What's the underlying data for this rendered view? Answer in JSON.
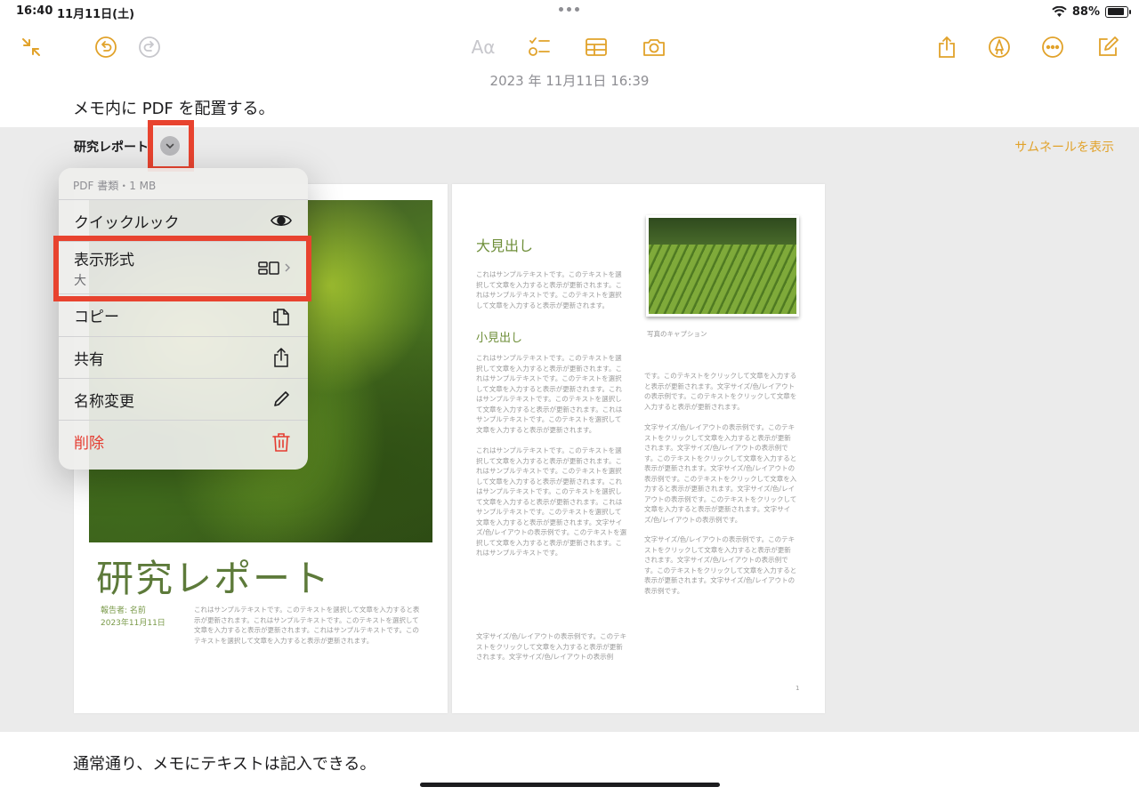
{
  "status_bar": {
    "time": "16:40",
    "date": "11月11日(土)",
    "battery": "88%"
  },
  "toolbar": {
    "font_button": "Aα",
    "icons": [
      "collapse-icon",
      "undo-icon",
      "redo-icon",
      "checklist-icon",
      "table-icon",
      "camera-icon",
      "share-icon",
      "markup-icon",
      "more-icon",
      "compose-icon"
    ]
  },
  "note": {
    "date": "2023 年 11月11日 16:39",
    "line1": "メモ内に PDF を配置する。",
    "line2": "通常通り、メモにテキストは記入できる。"
  },
  "attachment": {
    "title": "研究レポート",
    "thumbnail_link": "サムネールを表示"
  },
  "menu": {
    "header": "PDF 書類・1 MB",
    "items": [
      {
        "label": "クイックルック",
        "icon": "eye-icon"
      },
      {
        "label": "表示形式",
        "sublabel": "大",
        "icon": "layout-icon"
      },
      {
        "label": "コピー",
        "icon": "copy-icon"
      },
      {
        "label": "共有",
        "icon": "share-icon"
      },
      {
        "label": "名称変更",
        "icon": "pencil-icon"
      },
      {
        "label": "削除",
        "icon": "trash-icon"
      }
    ]
  },
  "pdf": {
    "left": {
      "title": "研究レポート",
      "meta1": "報告者: 名前",
      "meta2": "2023年11月11日",
      "body": "これはサンプルテキストです。このテキストを選択して文章を入力すると表示が更新されます。これはサンプルテキストです。このテキストを選択して文章を入力すると表示が更新されます。これはサンプルテキストです。このテキストを選択して文章を入力すると表示が更新されます。"
    },
    "right": {
      "heading_large": "大見出し",
      "heading_small": "小見出し",
      "para1": "これはサンプルテキストです。このテキストを選択して文章を入力すると表示が更新されます。これはサンプルテキストです。このテキストを選択して文章を入力すると表示が更新されます。",
      "para2": "これはサンプルテキストです。このテキストを選択して文章を入力すると表示が更新されます。これはサンプルテキストです。このテキストを選択して文章を入力すると表示が更新されます。これはサンプルテキストです。このテキストを選択して文章を入力すると表示が更新されます。これはサンプルテキストです。このテキストを選択して文章を入力すると表示が更新されます。",
      "para3": "これはサンプルテキストです。このテキストを選択して文章を入力すると表示が更新されます。これはサンプルテキストです。このテキストを選択して文章を入力すると表示が更新されます。これはサンプルテキストです。このテキストを選択して文章を入力すると表示が更新されます。これはサンプルテキストです。このテキストを選択して文章を入力すると表示が更新されます。文字サイズ/色/レイアウトの表示例です。このテキストを選択して文章を入力すると表示が更新されます。これはサンプルテキストです。",
      "para4": "文字サイズ/色/レイアウトの表示例です。このテキストをクリックして文章を入力すると表示が更新されます。文字サイズ/色/レイアウトの表示例",
      "caption": "写真のキャプション",
      "col2_para1": "です。このテキストをクリックして文章を入力すると表示が更新されます。文字サイズ/色/レイアウトの表示例です。このテキストをクリックして文章を入力すると表示が更新されます。",
      "col2_para2": "文字サイズ/色/レイアウトの表示例です。このテキストをクリックして文章を入力すると表示が更新されます。文字サイズ/色/レイアウトの表示例です。このテキストをクリックして文章を入力すると表示が更新されます。文字サイズ/色/レイアウトの表示例です。このテキストをクリックして文章を入力すると表示が更新されます。文字サイズ/色/レイアウトの表示例です。このテキストをクリックして文章を入力すると表示が更新されます。文字サイズ/色/レイアウトの表示例です。",
      "col2_para3": "文字サイズ/色/レイアウトの表示例です。このテキストをクリックして文章を入力すると表示が更新されます。文字サイズ/色/レイアウトの表示例です。このテキストをクリックして文章を入力すると表示が更新されます。文字サイズ/色/レイアウトの表示例です。",
      "page_number": "1"
    }
  },
  "colors": {
    "accent": "#e1a22a",
    "highlight": "#e8432f",
    "destructive": "#e53b30",
    "report_green": "#5d7a3a"
  }
}
